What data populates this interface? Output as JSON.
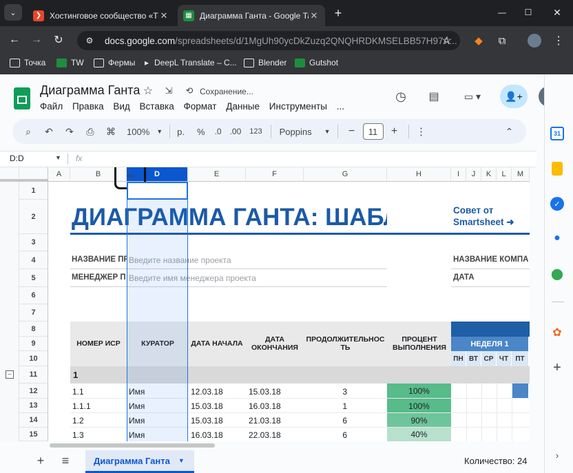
{
  "browser": {
    "tabs": [
      {
        "title": "Хостинговое сообщество «Tim",
        "favicon_color": "#e8452c",
        "active": false
      },
      {
        "title": "Диаграмма Ганта - Google Таб",
        "favicon_color": "#1e8e3e",
        "active": true
      }
    ],
    "new_tab_label": "+",
    "url_host": "docs.google.com",
    "url_path": "/spreadsheets/d/1MgUh90ycDkZuzq2QNQHRDKMSELBB57H97A...",
    "bookmarks": [
      "Точка",
      "TW",
      "Фермы",
      "DeepL Translate – C...",
      "Blender",
      "Gutshot"
    ]
  },
  "doc": {
    "title": "Диаграмма Ганта",
    "saving_status": "Сохранение...",
    "menu": [
      "Файл",
      "Правка",
      "Вид",
      "Вставка",
      "Формат",
      "Данные",
      "Инструменты",
      "..."
    ]
  },
  "toolbar": {
    "zoom": "100%",
    "currency": "р.",
    "percent": "%",
    "dec_decrease": ".0",
    "dec_increase": ".00",
    "number_format": "123",
    "font": "Poppins",
    "font_size": "11"
  },
  "formula_bar": {
    "name_box": "D:D",
    "fx": "fx"
  },
  "columns": [
    "A",
    "B",
    "D",
    "E",
    "F",
    "G",
    "H",
    "I",
    "J",
    "K",
    "L",
    "M"
  ],
  "rows": [
    "1",
    "2",
    "3",
    "4",
    "5",
    "6",
    "7",
    "8",
    "9",
    "10",
    "11",
    "12",
    "13",
    "14",
    "15"
  ],
  "sheet": {
    "big_title": "ДИАГРАММА ГАНТА: ШАБЛ",
    "tip_line1": "Совет от",
    "tip_line2": "Smartsheet ➜",
    "project_name_label": "НАЗВАНИЕ ПР",
    "project_name_placeholder": "Введите название проекта",
    "manager_label": "МЕНЕДЖЕР П",
    "manager_placeholder": "Введите имя менеджера проекта",
    "company_label": "НАЗВАНИЕ КОМПА",
    "date_label": "ДАТА",
    "headers": {
      "wbs": "НОМЕР ИСР",
      "curator": "КУРАТОР",
      "start": "ДАТА НАЧАЛА",
      "end": "ДАТА ОКОНЧАНИЯ",
      "duration": "ПРОДОЛЖИТЕЛЬНОСТЬ",
      "percent": "ПРОЦЕНТ ВЫПОЛНЕНИЯ",
      "week": "НЕДЕЛЯ 1",
      "days": [
        "ПН",
        "ВТ",
        "СР",
        "ЧТ",
        "ПТ"
      ]
    },
    "group_row": "1",
    "tasks": [
      {
        "id": "1.1",
        "curator": "Имя",
        "start": "12.03.18",
        "end": "15.03.18",
        "duration": "3",
        "percent": "100%",
        "pct_color": "#57bb8a"
      },
      {
        "id": "1.1.1",
        "curator": "Имя",
        "start": "15.03.18",
        "end": "16.03.18",
        "duration": "1",
        "percent": "100%",
        "pct_color": "#57bb8a"
      },
      {
        "id": "1.2",
        "curator": "Имя",
        "start": "15.03.18",
        "end": "21.03.18",
        "duration": "6",
        "percent": "90%",
        "pct_color": "#6ec59b"
      },
      {
        "id": "1.3",
        "curator": "Имя",
        "start": "16.03.18",
        "end": "22.03.18",
        "duration": "6",
        "percent": "40%",
        "pct_color": "#b7e1cd"
      }
    ]
  },
  "bottom": {
    "add_sheet": "+",
    "all_sheets": "≡",
    "active_sheet": "Диаграмма Ганта",
    "count_label": "Количество: 24"
  },
  "colors": {
    "title_blue": "#1b5aa6",
    "gantt_dark": "#1f5fa6",
    "gantt_light": "#4a86c8",
    "selection": "#1a73e8"
  }
}
